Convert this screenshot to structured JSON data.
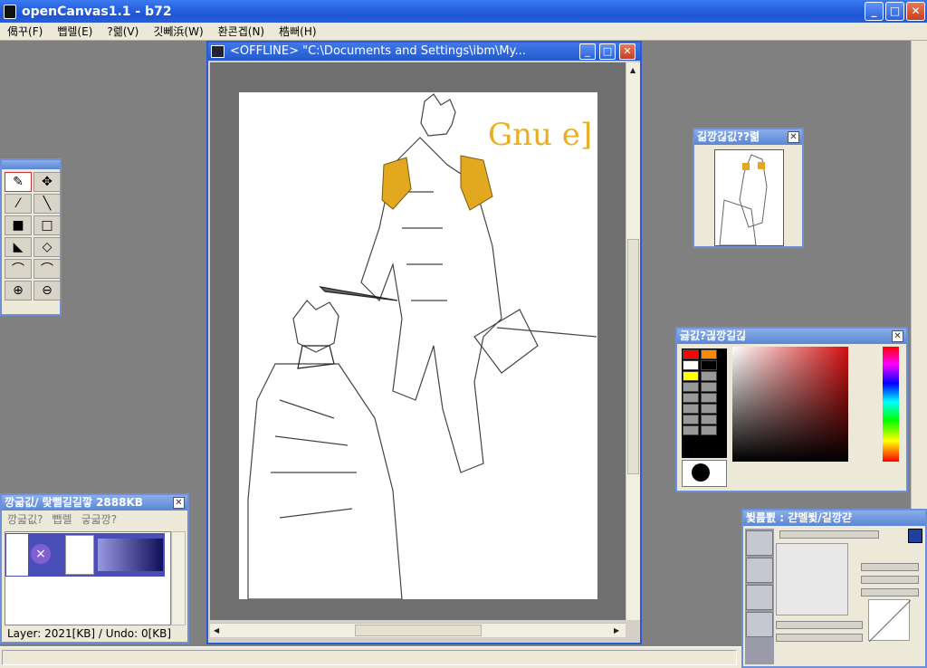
{
  "app": {
    "title": "openCanvas1.1 - b72",
    "min_label": "_",
    "max_label": "□",
    "close_label": "✕"
  },
  "menu": [
    {
      "label": "偈꾸(F)"
    },
    {
      "label": "뺍렐(E)"
    },
    {
      "label": "?렒(V)"
    },
    {
      "label": "깃뻬浜(W)"
    },
    {
      "label": "환콘겝(N)"
    },
    {
      "label": "梏뻐(H)"
    }
  ],
  "document": {
    "title": "<OFFLINE>  \"C:\\Documents and Settings\\ibm\\My...",
    "min_label": "_",
    "max_label": "□",
    "close_label": "✕",
    "signature": "Gnu e]"
  },
  "navigator": {
    "title": "긺깡긶깂??렮",
    "close_label": "✕"
  },
  "color_palette": {
    "title": "긇긼?긚깡길긶",
    "close_label": "✕",
    "current_color": "#000000",
    "swatch_colors": [
      "#ff0000",
      "#ff8800",
      "#ffffff",
      "#000000",
      "#ffff00",
      "#999999",
      "#999999",
      "#999999",
      "#999999",
      "#999999",
      "#999999",
      "#999999",
      "#999999",
      "#999999",
      "#999999",
      "#999999"
    ]
  },
  "layers": {
    "title": "깡긃깂/ 랓뻘길길깧 2888KB",
    "close_label": "✕",
    "tabs": [
      "깡긃깂?",
      "뺍렐",
      "긓긃깡?"
    ],
    "status": "Layer: 2021[KB] / Undo: 0[KB]"
  },
  "brush": {
    "title": "뷫릂뾠 : 갿멜뷫/길깡갿"
  },
  "tools": [
    {
      "name": "pen-tool-icon",
      "glyph": "✎"
    },
    {
      "name": "move-tool-icon",
      "glyph": "✥"
    },
    {
      "name": "eyedropper-tool-icon",
      "glyph": "⁄"
    },
    {
      "name": "line-tool-icon",
      "glyph": "╲"
    },
    {
      "name": "fill-color-tool-icon",
      "glyph": "■"
    },
    {
      "name": "rect-select-tool-icon",
      "glyph": "□"
    },
    {
      "name": "polygon-fill-tool-icon",
      "glyph": "◣"
    },
    {
      "name": "polygon-select-tool-icon",
      "glyph": "◇"
    },
    {
      "name": "curve-tool-icon",
      "glyph": "⌒"
    },
    {
      "name": "arc-tool-icon",
      "glyph": "⌒"
    },
    {
      "name": "zoom-in-tool-icon",
      "glyph": "⊕"
    },
    {
      "name": "zoom-out-tool-icon",
      "glyph": "⊖"
    }
  ]
}
